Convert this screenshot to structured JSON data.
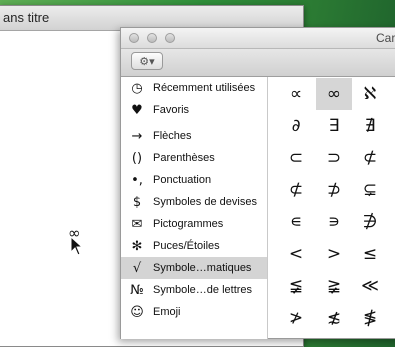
{
  "background_window": {
    "title": "ans titre"
  },
  "cursor_glyph": "∞",
  "panel": {
    "title": "Car",
    "gear_icon": "⚙▾"
  },
  "categories": [
    {
      "icon": "◷",
      "label": "Récemment utilisées"
    },
    {
      "icon": "♥",
      "label": "Favoris"
    },
    {
      "icon": "→",
      "label": "Flèches"
    },
    {
      "icon": "()",
      "label": "Parenthèses"
    },
    {
      "icon": "•,",
      "label": "Ponctuation"
    },
    {
      "icon": "$",
      "label": "Symboles de devises"
    },
    {
      "icon": "✉",
      "label": "Pictogrammes"
    },
    {
      "icon": "✻",
      "label": "Puces/Étoiles"
    },
    {
      "icon": "√",
      "label": "Symbole…matiques"
    },
    {
      "icon": "№",
      "label": "Symbole…de lettres"
    },
    {
      "icon": "☺",
      "label": "Emoji"
    }
  ],
  "selected_category": "Symbole…matiques",
  "glyphs": [
    "∝",
    "∞",
    "ℵ",
    "∂",
    "∃",
    "∄",
    "⊂",
    "⊃",
    "⊄",
    "⊄",
    "⊅",
    "⊊",
    "∊",
    "∍",
    "∌",
    "<",
    ">",
    "≤",
    "≨",
    "≩",
    "≪",
    "≯",
    "≴",
    "≸"
  ],
  "selected_glyph": "∞"
}
